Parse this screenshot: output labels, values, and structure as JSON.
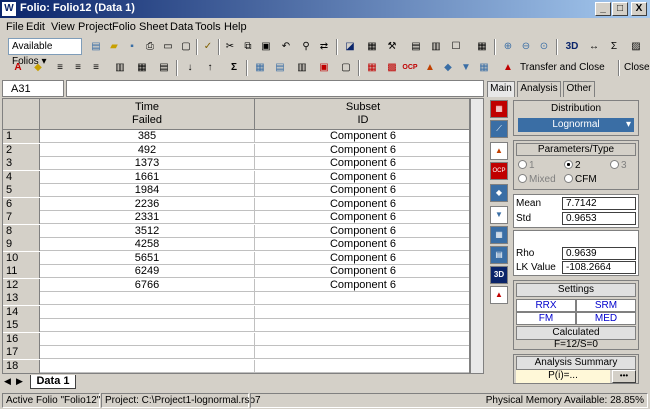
{
  "window": {
    "app_icon": "W",
    "title": "Folio: Folio12 (Data 1)",
    "min": "_",
    "max": "□",
    "close": "X"
  },
  "menu": [
    "File",
    "Edit",
    "View",
    "Project",
    "Folio",
    "Sheet",
    "Data",
    "Tools",
    "Help"
  ],
  "toolbar": {
    "folios_combo": "Available Folios ▾",
    "transfer": "Transfer and Close",
    "close": "Close"
  },
  "cell_ref": "A31",
  "grid": {
    "col1_header": [
      "Time",
      "Failed"
    ],
    "col2_header": [
      "Subset",
      "ID"
    ],
    "rows": [
      [
        "1",
        "385",
        "Component 6"
      ],
      [
        "2",
        "492",
        "Component 6"
      ],
      [
        "3",
        "1373",
        "Component 6"
      ],
      [
        "4",
        "1661",
        "Component 6"
      ],
      [
        "5",
        "1984",
        "Component 6"
      ],
      [
        "6",
        "2236",
        "Component 6"
      ],
      [
        "7",
        "2331",
        "Component 6"
      ],
      [
        "8",
        "3512",
        "Component 6"
      ],
      [
        "9",
        "4258",
        "Component 6"
      ],
      [
        "10",
        "5651",
        "Component 6"
      ],
      [
        "11",
        "6249",
        "Component 6"
      ],
      [
        "12",
        "6766",
        "Component 6"
      ],
      [
        "13",
        "",
        ""
      ],
      [
        "14",
        "",
        ""
      ],
      [
        "15",
        "",
        ""
      ],
      [
        "16",
        "",
        ""
      ],
      [
        "17",
        "",
        ""
      ],
      [
        "18",
        "",
        ""
      ]
    ]
  },
  "sheet_tab": "Data 1",
  "status": {
    "folio": "Active Folio \"Folio12\"",
    "project": "Project: C:\\Project1-lognormal.rso7",
    "memory": "Physical Memory Available: 28.85%"
  },
  "panel": {
    "tabs": [
      "Main",
      "Analysis",
      "Other"
    ],
    "distribution_label": "Distribution",
    "distribution_value": "Lognormal",
    "params_label": "Parameters/Type",
    "radios": [
      "1",
      "2",
      "3",
      "Mixed",
      "CFM"
    ],
    "mean_label": "Mean",
    "mean_value": "7.7142",
    "std_label": "Std",
    "std_value": "0.9653",
    "rho_label": "Rho",
    "rho_value": "0.9639",
    "lk_label": "LK Value",
    "lk_value": "-108.2664",
    "settings_label": "Settings",
    "rrx": "RRX",
    "srm": "SRM",
    "fm": "FM",
    "med": "MED",
    "calculated_label": "Calculated",
    "fs": "F=12/S=0",
    "summary_label": "Analysis Summary",
    "summary_value": "P(i)=...",
    "summary_btn": "•••"
  },
  "colors": {
    "titlebar": "#0a246a",
    "accent": "#3a6ea5",
    "window_bg": "#d4d0c8"
  }
}
